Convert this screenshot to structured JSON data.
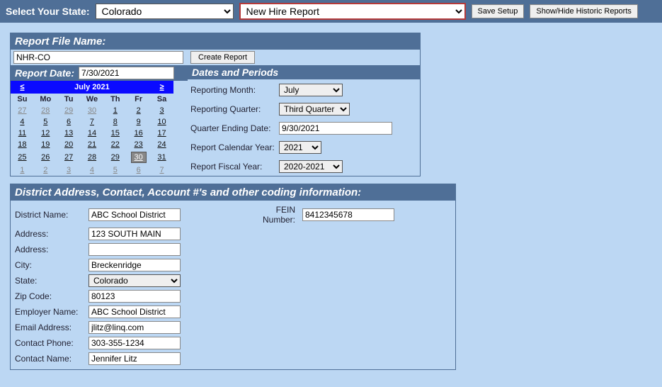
{
  "topbar": {
    "label": "Select Your State:",
    "state": "Colorado",
    "report": "New Hire Report",
    "save": "Save Setup",
    "historic": "Show/Hide Historic Reports"
  },
  "fileName": {
    "header": "Report File Name:",
    "value": "NHR-CO",
    "create": "Create Report"
  },
  "reportDate": {
    "header": "Report Date:",
    "value": "7/30/2021"
  },
  "calendar": {
    "title": "July 2021",
    "prev": "≤",
    "next": "≥",
    "dow": [
      "Su",
      "Mo",
      "Tu",
      "We",
      "Th",
      "Fr",
      "Sa"
    ],
    "weeks": [
      [
        {
          "n": "27",
          "o": true
        },
        {
          "n": "28",
          "o": true
        },
        {
          "n": "29",
          "o": true
        },
        {
          "n": "30",
          "o": true
        },
        {
          "n": "1"
        },
        {
          "n": "2"
        },
        {
          "n": "3"
        }
      ],
      [
        {
          "n": "4"
        },
        {
          "n": "5"
        },
        {
          "n": "6"
        },
        {
          "n": "7"
        },
        {
          "n": "8"
        },
        {
          "n": "9"
        },
        {
          "n": "10"
        }
      ],
      [
        {
          "n": "11"
        },
        {
          "n": "12"
        },
        {
          "n": "13"
        },
        {
          "n": "14"
        },
        {
          "n": "15"
        },
        {
          "n": "16"
        },
        {
          "n": "17"
        }
      ],
      [
        {
          "n": "18"
        },
        {
          "n": "19"
        },
        {
          "n": "20"
        },
        {
          "n": "21"
        },
        {
          "n": "22"
        },
        {
          "n": "23"
        },
        {
          "n": "24"
        }
      ],
      [
        {
          "n": "25"
        },
        {
          "n": "26"
        },
        {
          "n": "27"
        },
        {
          "n": "28"
        },
        {
          "n": "29"
        },
        {
          "n": "30",
          "sel": true
        },
        {
          "n": "31"
        }
      ],
      [
        {
          "n": "1",
          "o": true
        },
        {
          "n": "2",
          "o": true
        },
        {
          "n": "3",
          "o": true
        },
        {
          "n": "4",
          "o": true
        },
        {
          "n": "5",
          "o": true
        },
        {
          "n": "6",
          "o": true
        },
        {
          "n": "7",
          "o": true
        }
      ]
    ]
  },
  "dates": {
    "header": "Dates and Periods",
    "monthLbl": "Reporting Month:",
    "month": "July",
    "quarterLbl": "Reporting Quarter:",
    "quarter": "Third Quarter",
    "qEndLbl": "Quarter Ending Date:",
    "qEnd": "9/30/2021",
    "calYearLbl": "Report Calendar Year:",
    "calYear": "2021",
    "fiscalLbl": "Report Fiscal Year:",
    "fiscal": "2020-2021"
  },
  "contact": {
    "header": "District Address, Contact, Account #'s and other coding information:",
    "districtLbl": "District Name:",
    "district": "ABC School District",
    "addr1Lbl": "Address:",
    "addr1": "123 SOUTH MAIN",
    "addr2Lbl": "Address:",
    "addr2": "",
    "cityLbl": "City:",
    "city": "Breckenridge",
    "stateLbl": "State:",
    "state": "Colorado",
    "zipLbl": "Zip Code:",
    "zip": "80123",
    "empLbl": "Employer Name:",
    "emp": "ABC School District",
    "emailLbl": "Email Address:",
    "email": "jlitz@linq.com",
    "phoneLbl": "Contact Phone:",
    "phone": "303-355-1234",
    "cnameLbl": "Contact Name:",
    "cname": "Jennifer Litz",
    "feinLbl": "FEIN Number:",
    "fein": "8412345678"
  }
}
